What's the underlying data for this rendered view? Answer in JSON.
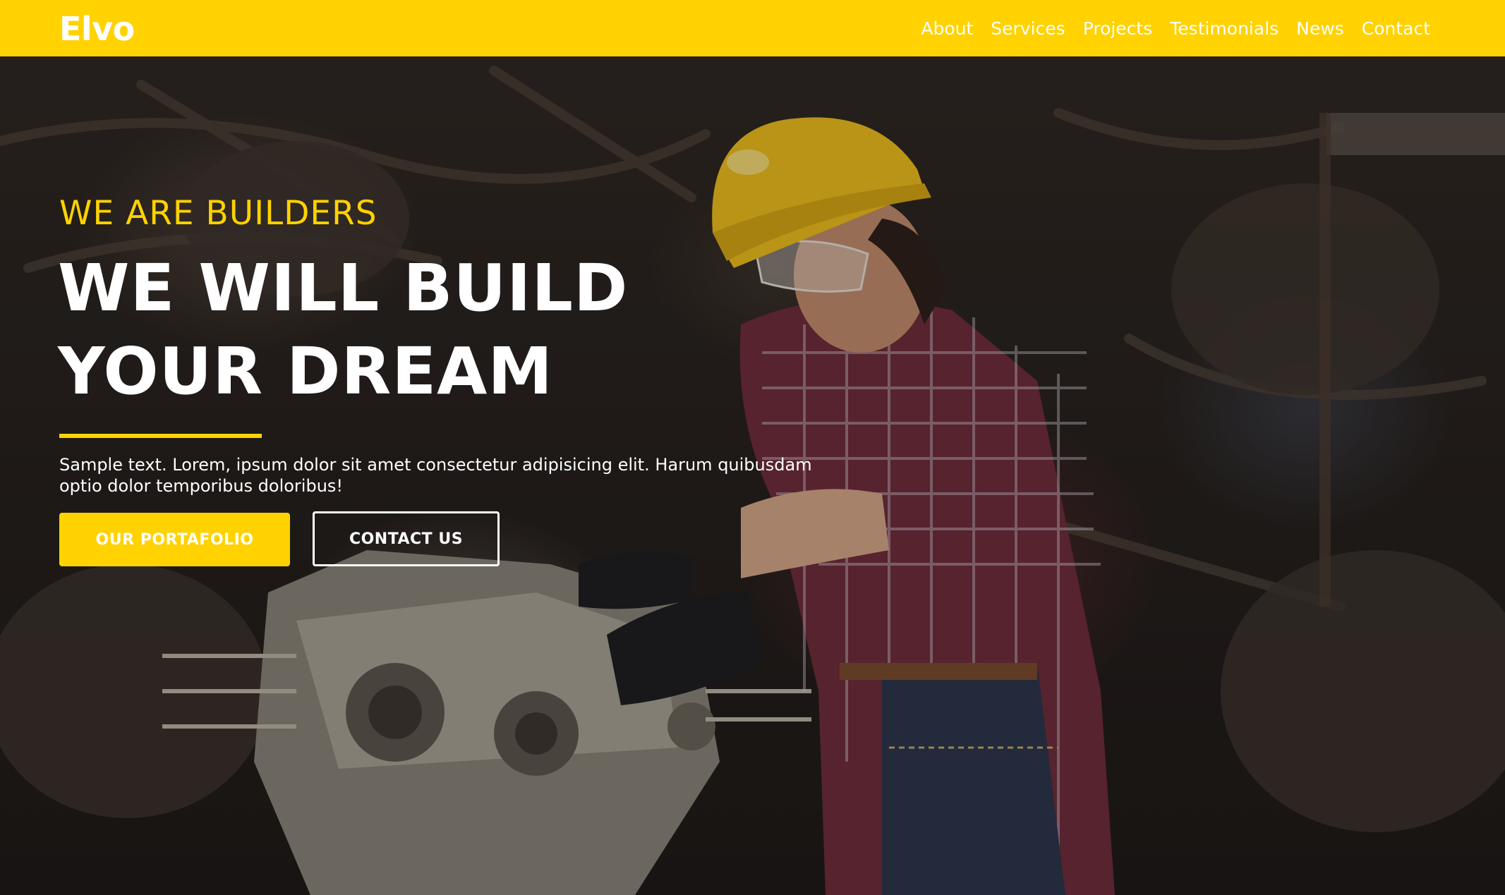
{
  "brand": {
    "logo": "Elvo",
    "accent_color": "#ffd200"
  },
  "nav": {
    "items": [
      {
        "label": "About"
      },
      {
        "label": "Services"
      },
      {
        "label": "Projects"
      },
      {
        "label": "Testimonials"
      },
      {
        "label": "News"
      },
      {
        "label": "Contact"
      }
    ]
  },
  "hero": {
    "eyebrow": "WE ARE BUILDERS",
    "headline_line1": "WE WILL BUILD",
    "headline_line2": "YOUR DREAM",
    "body": "Sample text. Lorem, ipsum dolor sit amet consectetur adipisicing elit. Harum quibusdam optio dolor temporibus doloribus!",
    "primary_button": "OUR PORTAFOLIO",
    "secondary_button": "CONTACT US",
    "background_image": "worker-in-hardhat-repairing-engine-photo"
  }
}
